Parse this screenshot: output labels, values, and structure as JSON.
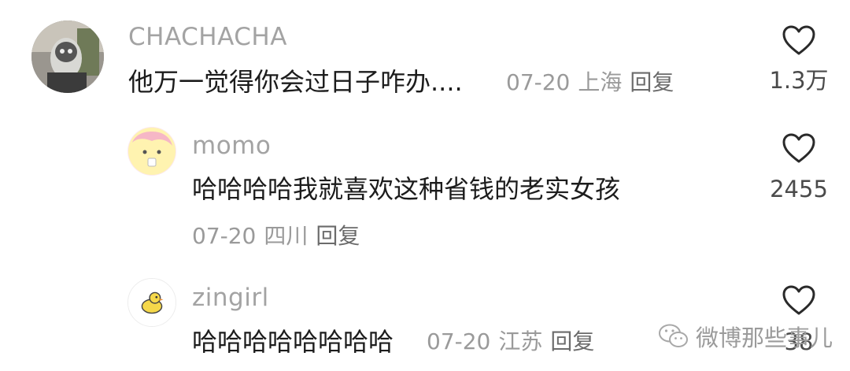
{
  "comments": [
    {
      "username": "CHACHACHA",
      "text": "他万一觉得你会过日子咋办....",
      "date": "07-20",
      "location": "上海",
      "reply_label": "回复",
      "likes": "1.3万"
    },
    {
      "username": "momo",
      "text": "哈哈哈哈我就喜欢这种省钱的老实女孩",
      "date": "07-20",
      "location": "四川",
      "reply_label": "回复",
      "likes": "2455"
    },
    {
      "username": "zingirl",
      "text": "哈哈哈哈哈哈哈哈",
      "date": "07-20",
      "location": "江苏",
      "reply_label": "回复",
      "likes": "38"
    }
  ],
  "watermark": {
    "text": "微博那些事儿",
    "icon": "wechat-icon"
  },
  "colors": {
    "username": "#a3a3a3",
    "content": "#1c1c1c",
    "meta": "#9a9a9a",
    "heart_stroke": "#2a2a2a"
  }
}
